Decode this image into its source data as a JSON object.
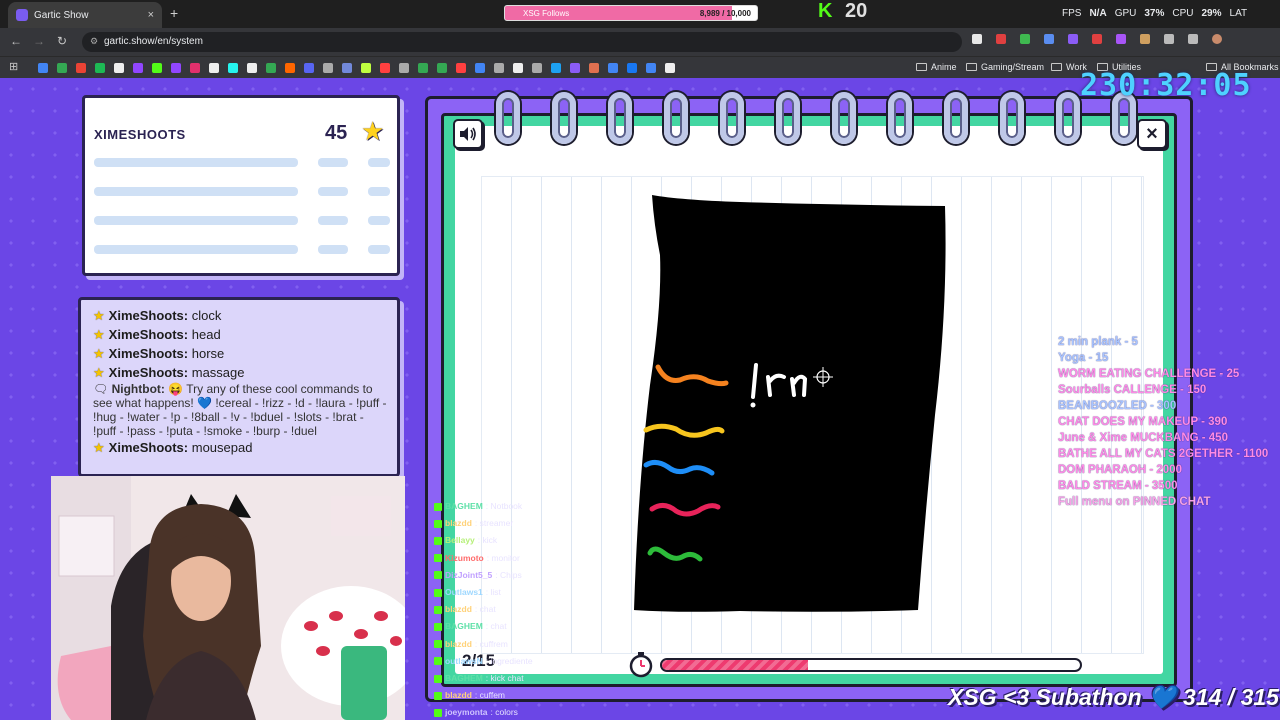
{
  "browser": {
    "tab_title": "Gartic Show",
    "tab_close": "×",
    "new_tab": "+",
    "url": "gartic.show/en/system",
    "follow_goal": {
      "label": "XSG Follows",
      "count": "8,989 / 10,000",
      "progress": 0.8989
    },
    "kick": {
      "badge": "K",
      "viewers": "20"
    },
    "stats": {
      "fps_label": "FPS",
      "fps": "N/A",
      "gpu_label": "GPU",
      "gpu": "37%",
      "cpu_label": "CPU",
      "cpu": "29%",
      "lat_label": "LAT"
    },
    "bookmarks": [
      "Anime",
      "Gaming/Stream",
      "Work",
      "Utilities",
      "All Bookmarks"
    ]
  },
  "overlay": {
    "clock": "230:32:05",
    "subathon_title": "XSG <3 Subathon",
    "subathon_heart": "💙",
    "subathon_count": "314 / 315"
  },
  "player": {
    "name": "XIMESHOOTS",
    "score": "45"
  },
  "game_chat": [
    {
      "user": "XimeShoots:",
      "text": "clock"
    },
    {
      "user": "XimeShoots:",
      "text": "head"
    },
    {
      "user": "XimeShoots:",
      "text": "horse"
    },
    {
      "user": "XimeShoots:",
      "text": "massage"
    },
    {
      "user": "Nightbot:",
      "text": "😝 Try any of these cool commands to see what happens! 💙 !cereal - !rizz - !d - !laura - !puff - !hug - !water - !p - !8ball - !v - !bduel - !slots - !brat - !puff - !pass - !puta - !smoke - !burp - !duel"
    },
    {
      "user": "XimeShoots:",
      "text": "mousepad"
    }
  ],
  "drawing": {
    "round": "2/15",
    "timer_progress": 0.35
  },
  "menu": [
    {
      "text": "2 min plank  -  5",
      "style": "normal"
    },
    {
      "text": "Yoga  -  15",
      "style": "normal"
    },
    {
      "text": "WORM EATING CHALLENGE - 25",
      "style": "hi"
    },
    {
      "text": "Sourballs CALLENGE - 150",
      "style": "hi"
    },
    {
      "text": "BEANBOOZLED - 300",
      "style": "normal"
    },
    {
      "text": "CHAT DOES MY MAKEUP - 390",
      "style": "hi"
    },
    {
      "text": "June & Xime MUCKBANG - 450",
      "style": "hi"
    },
    {
      "text": "BATHE ALL MY CATS 2GETHER - 1100",
      "style": "hi"
    },
    {
      "text": "DOM PHARAOH - 2000",
      "style": "hi"
    },
    {
      "text": "BALD STREAM - 3500",
      "style": "hi"
    },
    {
      "text": "Full menu on PINNED CHAT",
      "style": "pink"
    }
  ],
  "kick_chat": [
    {
      "user": "BAGHEM",
      "text": ": Notbook",
      "color": "#5ee0a8"
    },
    {
      "user": "blazdd",
      "text": ": streamer",
      "color": "#ffd27a"
    },
    {
      "user": "Bellayy",
      "text": ": kick",
      "color": "#b7f07a"
    },
    {
      "user": "Kizumoto",
      "text": ": monitor",
      "color": "#ff6b6b"
    },
    {
      "user": "DizJoint5_5",
      "text": ": Chips",
      "color": "#c0a0ff"
    },
    {
      "user": "Outlaws1",
      "text": ": list",
      "color": "#9fd8ff"
    },
    {
      "user": "blazdd",
      "text": ": chat",
      "color": "#ffd27a"
    },
    {
      "user": "BAGHEM",
      "text": ": chat",
      "color": "#5ee0a8"
    },
    {
      "user": "blazdd",
      "text": ": cuffrem",
      "color": "#ffd27a"
    },
    {
      "user": "outlawsN",
      "text": ": ingrediente",
      "color": "#9fd8ff"
    },
    {
      "user": "BAGHEM",
      "text": ": kick chat",
      "color": "#5ee0a8"
    },
    {
      "user": "blazdd",
      "text": ": cuffem",
      "color": "#ffd27a"
    },
    {
      "user": "joeymonta",
      "text": ": colors",
      "color": "#d0c4ff"
    }
  ],
  "icons": {
    "sound": "speaker-icon",
    "close": "×",
    "star": "★",
    "clock": "stopwatch-icon"
  },
  "colors": {
    "background": "#6b46e6",
    "notebook_frame": "#8c63f5",
    "notebook_inner": "#43d6a2",
    "accent_pink": "#ee3a6f",
    "clock_cyan": "#4ed2ff"
  }
}
